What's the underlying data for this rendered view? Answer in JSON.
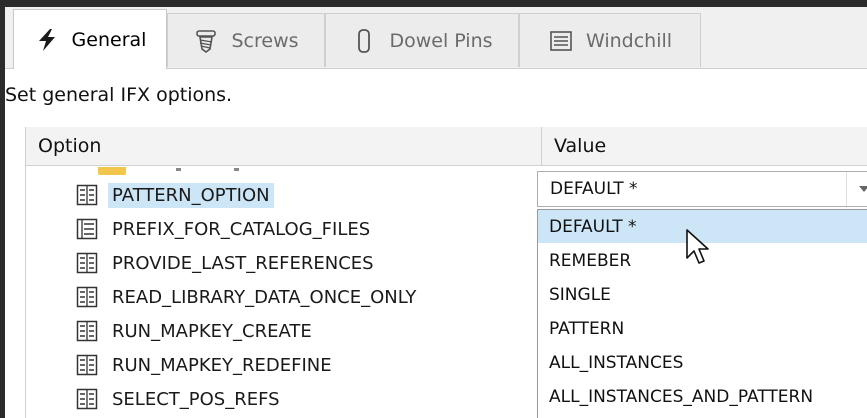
{
  "tabs": [
    {
      "label": "General",
      "icon": "lightning-icon",
      "active": true
    },
    {
      "label": "Screws",
      "icon": "screw-icon",
      "active": false
    },
    {
      "label": "Dowel Pins",
      "icon": "dowel-pin-icon",
      "active": false
    },
    {
      "label": "Windchill",
      "icon": "windchill-icon",
      "active": false
    }
  ],
  "description": "Set general IFX options.",
  "grid": {
    "col_option": "Option",
    "col_value": "Value"
  },
  "rows": [
    {
      "label": "PATTERN_OPTION",
      "icon": "option-list-icon",
      "selected": true
    },
    {
      "label": "PREFIX_FOR_CATALOG_FILES",
      "icon": "option-text-icon",
      "selected": false
    },
    {
      "label": "PROVIDE_LAST_REFERENCES",
      "icon": "option-list-icon",
      "selected": false
    },
    {
      "label": "READ_LIBRARY_DATA_ONCE_ONLY",
      "icon": "option-list-icon",
      "selected": false
    },
    {
      "label": "RUN_MAPKEY_CREATE",
      "icon": "option-list-icon",
      "selected": false
    },
    {
      "label": "RUN_MAPKEY_REDEFINE",
      "icon": "option-list-icon",
      "selected": false
    },
    {
      "label": "SELECT_POS_REFS",
      "icon": "option-list-icon",
      "selected": false
    }
  ],
  "value_combo": {
    "selected": "DEFAULT *",
    "options": [
      "DEFAULT *",
      "REMEBER",
      "SINGLE",
      "PATTERN",
      "ALL_INSTANCES",
      "ALL_INSTANCES_AND_PATTERN"
    ],
    "highlighted_index": 0
  },
  "colors": {
    "selection": "#cce6f8",
    "tab_background": "#f0f0f0",
    "frame": "#2b2b2b"
  }
}
